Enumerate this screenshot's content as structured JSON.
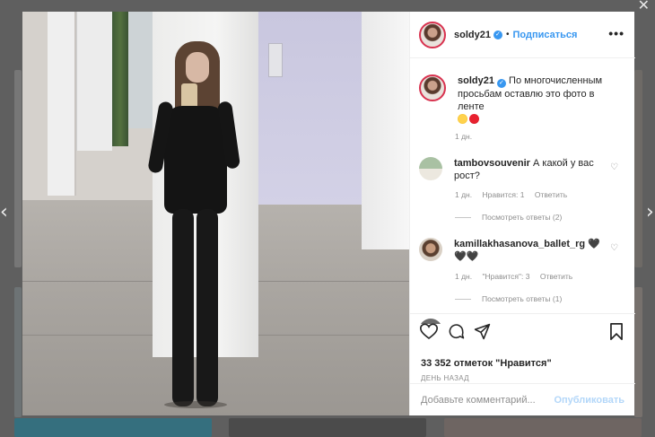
{
  "overlay": {
    "close_icon": "✕",
    "prev_icon": "‹",
    "next_icon": "›"
  },
  "post": {
    "username": "soldy21",
    "verified_icon": "✓",
    "follow_label": "Подписаться",
    "more_icon": "•••",
    "caption": "По многочисленным просьбам оставлю это фото в ленте",
    "caption_time": "1 дн.",
    "caption_emojis": [
      "grinning-sweat-emoji",
      "red-heart-emoji"
    ]
  },
  "comments": [
    {
      "username": "tambovsouvenir",
      "text": "А какой у вас рост?",
      "time": "1 дн.",
      "likes": "Нравится: 1",
      "reply_label": "Ответить",
      "view_replies": "Посмотреть ответы (2)"
    },
    {
      "username": "kamillakhasanova_ballet_rg",
      "text": "🖤🖤🖤",
      "time": "1 дн.",
      "likes": "\"Нравится\": 3",
      "reply_label": "Ответить",
      "view_replies": "Посмотреть ответы (1)"
    }
  ],
  "partial_comment": "",
  "actions": {
    "likes_count": "33 352 отметок \"Нравится\"",
    "posted_ago": "ДЕНЬ НАЗАД",
    "add_comment_placeholder": "Добавьте комментарий...",
    "publish_label": "Опубликовать"
  },
  "colors": {
    "accent": "#3897f0",
    "text": "#262626",
    "muted": "#8e8e8e",
    "ring": "#d8324f",
    "publish_disabled": "#b3d7f9"
  }
}
